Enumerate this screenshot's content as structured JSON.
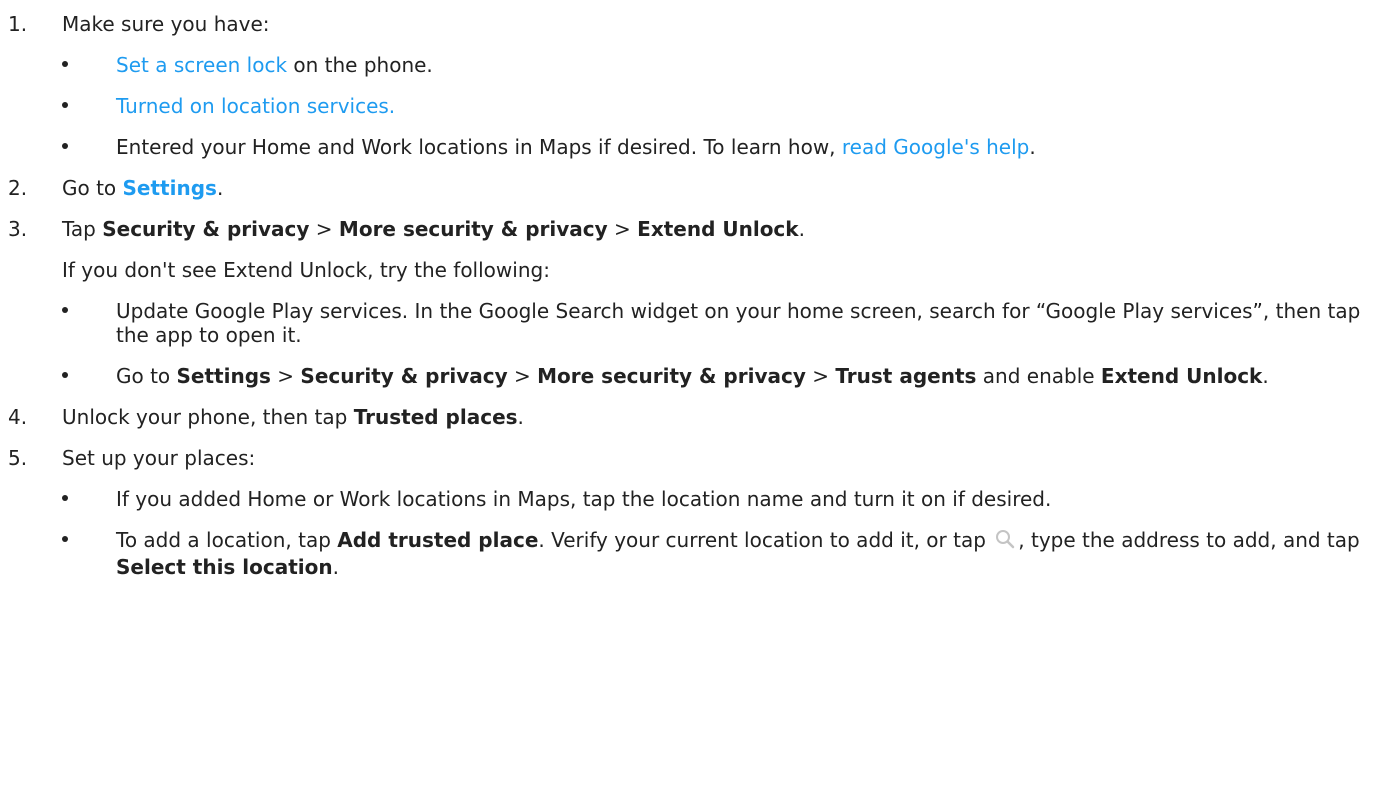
{
  "steps": [
    {
      "number": "1.",
      "text": "Make sure you have:",
      "bullets": [
        {
          "link": "Set a screen lock",
          "after": " on the phone."
        },
        {
          "link": "Turned on location services."
        },
        {
          "before": "Entered your Home and Work locations in Maps if desired. To learn how, ",
          "link": "read Google's help",
          "after": "."
        }
      ]
    },
    {
      "number": "2.",
      "before": "Go to ",
      "link": "Settings",
      "after": "."
    },
    {
      "number": "3.",
      "t1": "Tap ",
      "b1": "Security & privacy",
      "t2": " > ",
      "b2": "More security & privacy",
      "t3": " > ",
      "b3": "Extend Unlock",
      "t4": ".",
      "note": "If you don't see Extend Unlock, try the following:",
      "bullets": [
        {
          "text": "Update Google Play services. In the Google Search widget on your home screen, search for “Google Play services”, then tap the app to open it."
        },
        {
          "t1": "Go to ",
          "b1": "Settings",
          "t2": " > ",
          "b2": "Security & privacy",
          "t3": " > ",
          "b3": "More security & privacy",
          "t4": " > ",
          "b4": "Trust agents",
          "t5": " and enable ",
          "b5": "Extend Unlock",
          "t6": "."
        }
      ]
    },
    {
      "number": "4.",
      "before": "Unlock your phone, then tap ",
      "bold": "Trusted places",
      "after": "."
    },
    {
      "number": "5.",
      "text": "Set up your places:",
      "bullets": [
        {
          "text": "If you added Home or Work locations in Maps, tap the location name and turn it on if desired."
        },
        {
          "t1": "To add a location, tap ",
          "b1": "Add trusted place",
          "t2": ". Verify your current location to add it, or tap ",
          "icon": "search-icon",
          "t3": ", type the address to add, and tap ",
          "b2": "Select this location",
          "t4": "."
        }
      ]
    }
  ],
  "colors": {
    "text": "#222222",
    "link": "#1e9bf0"
  }
}
